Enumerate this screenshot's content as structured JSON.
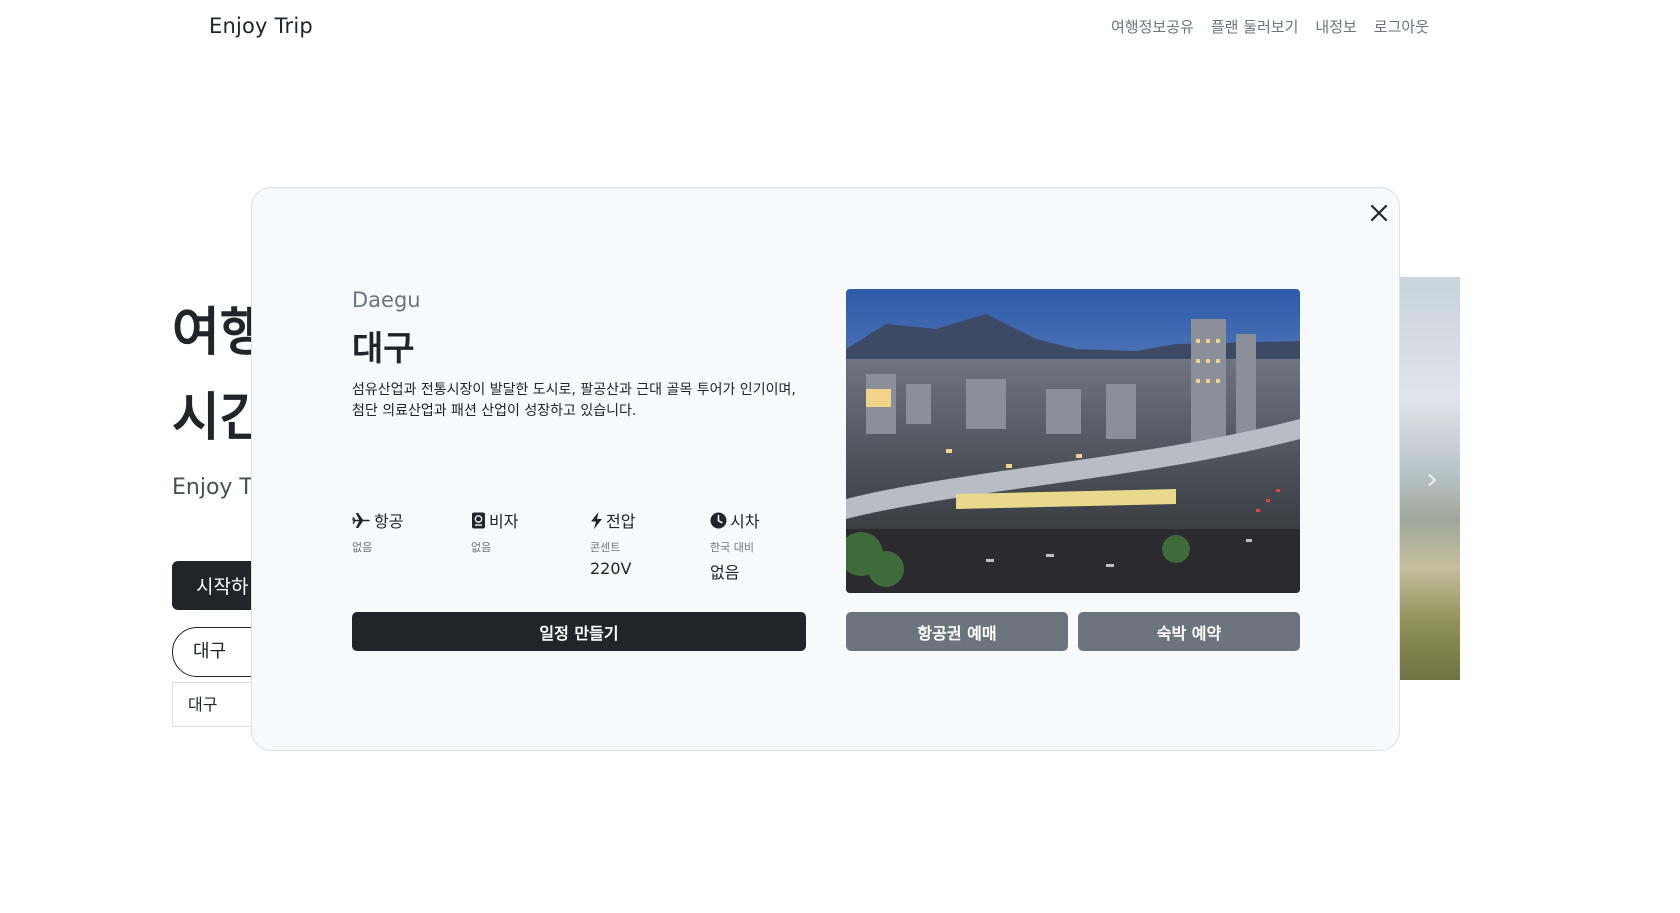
{
  "header": {
    "brand": "Enjoy Trip",
    "nav": [
      "여행정보공유",
      "플랜 둘러보기",
      "내정보",
      "로그아웃"
    ]
  },
  "hero": {
    "title_line1": "여행",
    "title_line2": "시간",
    "subtitle": "Enjoy Tr",
    "start_label": "시작하",
    "search_value": "대구",
    "suggestion": "대구"
  },
  "modal": {
    "city_en": "Daegu",
    "city_ko": "대구",
    "description_line1": "섬유산업과 전통시장이 발달한 도시로, 팔공산과 근대 골목 투어가 인기이며,",
    "description_line2": "첨단 의료산업과 패션 산업이 성장하고 있습니다.",
    "info": [
      {
        "icon": "airplane-icon",
        "label": "항공",
        "sub": "없음",
        "value": ""
      },
      {
        "icon": "passport-icon",
        "label": "비자",
        "sub": "없음",
        "value": ""
      },
      {
        "icon": "lightning-icon",
        "label": "전압",
        "sub": "콘센트",
        "value": "220V"
      },
      {
        "icon": "clock-icon",
        "label": "시차",
        "sub": "한국 대비",
        "value": "없음"
      }
    ],
    "plan_button": "일정 만들기",
    "flight_button": "항공권 예매",
    "hotel_button": "숙박 예약"
  }
}
